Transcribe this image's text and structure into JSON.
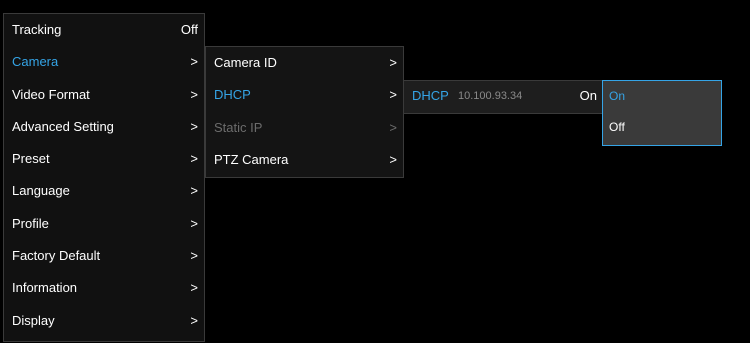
{
  "main_menu": {
    "items": [
      {
        "label": "Tracking",
        "right": "Off"
      },
      {
        "label": "Camera",
        "right": ">"
      },
      {
        "label": "Video Format",
        "right": ">"
      },
      {
        "label": "Advanced Setting",
        "right": ">"
      },
      {
        "label": "Preset",
        "right": ">"
      },
      {
        "label": "Language",
        "right": ">"
      },
      {
        "label": "Profile",
        "right": ">"
      },
      {
        "label": "Factory Default",
        "right": ">"
      },
      {
        "label": "Information",
        "right": ">"
      },
      {
        "label": "Display",
        "right": ">"
      }
    ]
  },
  "camera_menu": {
    "items": [
      {
        "label": "Camera ID",
        "right": ">"
      },
      {
        "label": "DHCP",
        "right": ">"
      },
      {
        "label": "Static IP",
        "right": ">"
      },
      {
        "label": "PTZ Camera",
        "right": ">"
      }
    ]
  },
  "dhcp_panel": {
    "label": "DHCP",
    "ip": "10.100.93.34",
    "value": "On"
  },
  "onoff_menu": {
    "options": [
      "On",
      "Off"
    ],
    "selected": "On"
  },
  "colors": {
    "accent": "#35a4e6",
    "disabled": "#6c6c6c"
  }
}
